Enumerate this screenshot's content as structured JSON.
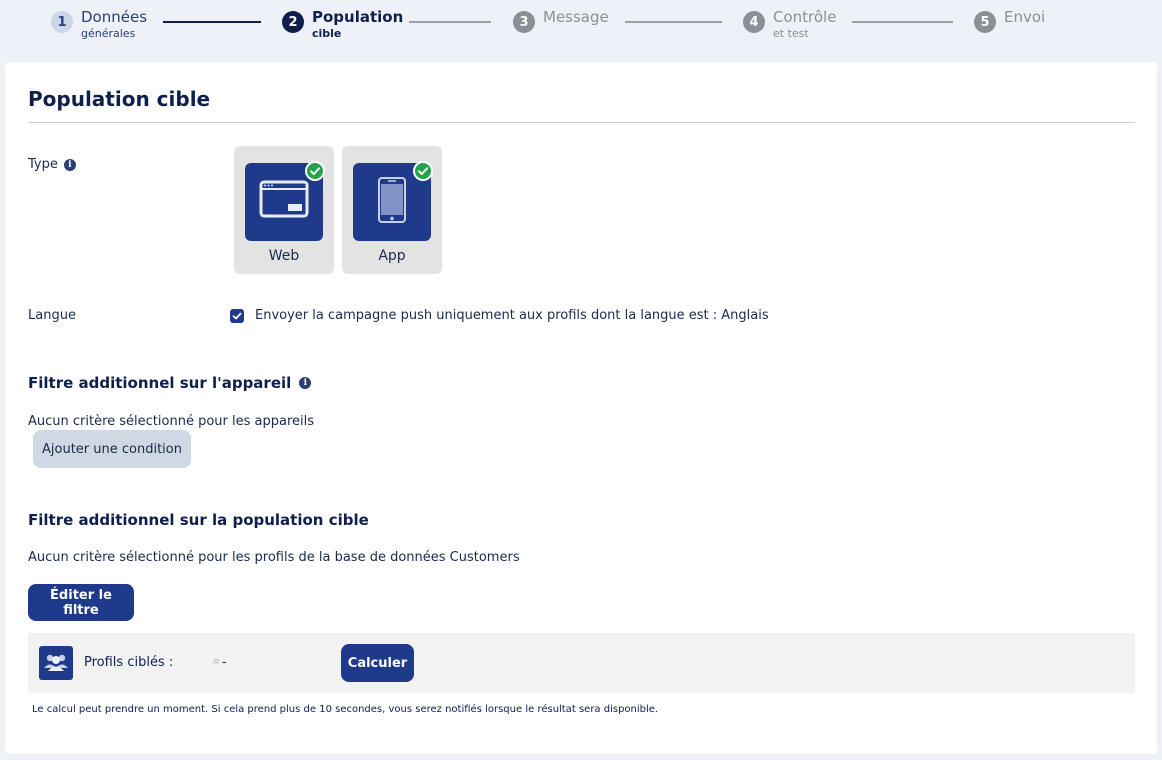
{
  "stepper": {
    "steps": [
      {
        "num": "1",
        "label": "Données",
        "sub": "générales",
        "state": "done"
      },
      {
        "num": "2",
        "label": "Population",
        "sub": "cible",
        "state": "active"
      },
      {
        "num": "3",
        "label": "Message",
        "sub": "",
        "state": "todo"
      },
      {
        "num": "4",
        "label": "Contrôle",
        "sub": "et test",
        "state": "todo"
      },
      {
        "num": "5",
        "label": "Envoi",
        "sub": "",
        "state": "todo"
      }
    ]
  },
  "page": {
    "title": "Population cible"
  },
  "type_section": {
    "label": "Type",
    "info_icon": "info-icon",
    "options": [
      {
        "label": "Web",
        "icon": "browser-window-icon",
        "selected": true
      },
      {
        "label": "App",
        "icon": "smartphone-icon",
        "selected": true
      }
    ]
  },
  "language": {
    "label": "Langue",
    "checked": true,
    "text": "Envoyer la campagne push uniquement aux profils dont la langue est : Anglais"
  },
  "device_filter": {
    "title": "Filtre additionnel sur l'appareil",
    "info_icon": "info-icon",
    "empty_text": "Aucun critère sélectionné pour les appareils",
    "add_button": "Ajouter une condition"
  },
  "population_filter": {
    "title": "Filtre additionnel sur la population cible",
    "empty_text": "Aucun critère sélectionné pour les profils de la base de données Customers",
    "edit_button": "Éditer le filtre"
  },
  "profiles": {
    "icon": "users-icon",
    "label": "Profils ciblés :",
    "hash": "#",
    "value": "-",
    "calc_button": "Calculer",
    "note": "Le calcul peut prendre un moment. Si cela prend plus de 10 secondes, vous serez notifiés lorsque le résultat sera disponible."
  },
  "colors": {
    "primary": "#1f3a8a",
    "navy": "#0e1f4d",
    "success": "#23a34b",
    "background": "#eef1f7"
  }
}
